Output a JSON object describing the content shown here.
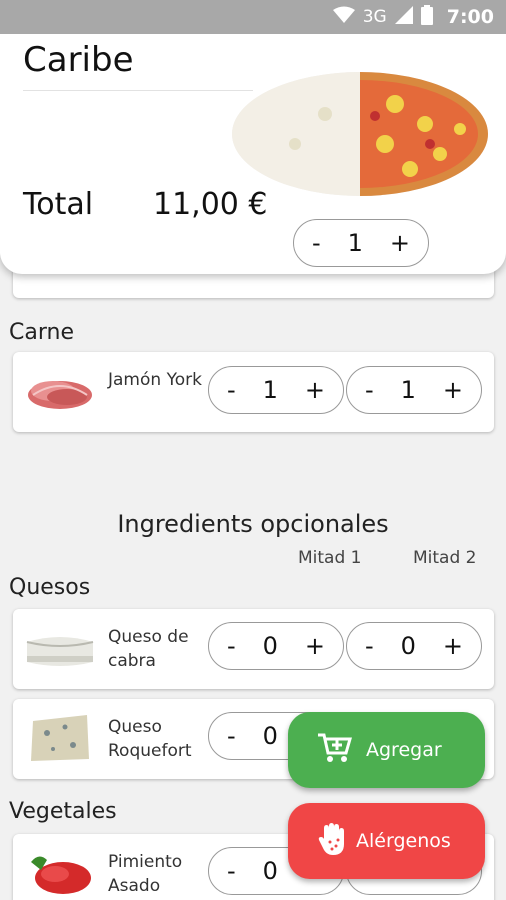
{
  "status_bar": {
    "network": "3G",
    "time": "7:00"
  },
  "header": {
    "title": "Caribe",
    "total_label": "Total",
    "total_value": "11,00 €",
    "quantity": {
      "minus": "-",
      "value": "1",
      "plus": "+"
    }
  },
  "sections": {
    "carne": "Carne",
    "quesos": "Quesos",
    "vegetales": "Vegetales"
  },
  "optional": {
    "title": "Ingredients opcionales",
    "mitad1": "Mitad 1",
    "mitad2": "Mitad 2"
  },
  "items": {
    "jamon": {
      "name": "Jamón York",
      "half1": "1",
      "half2": "1"
    },
    "cabra": {
      "name": "Queso de cabra",
      "half1": "0",
      "half2": "0"
    },
    "roquefort": {
      "name": "Queso Roquefort",
      "half1": "0"
    },
    "pimiento": {
      "name": "Pimiento Asado",
      "half1": "0"
    }
  },
  "controls": {
    "minus": "-",
    "plus": "+"
  },
  "buttons": {
    "agregar": "Agregar",
    "alergenos": "Alérgenos"
  },
  "colors": {
    "green": "#4caf50",
    "red": "#f04646",
    "status_bar": "#a8a8a8"
  }
}
